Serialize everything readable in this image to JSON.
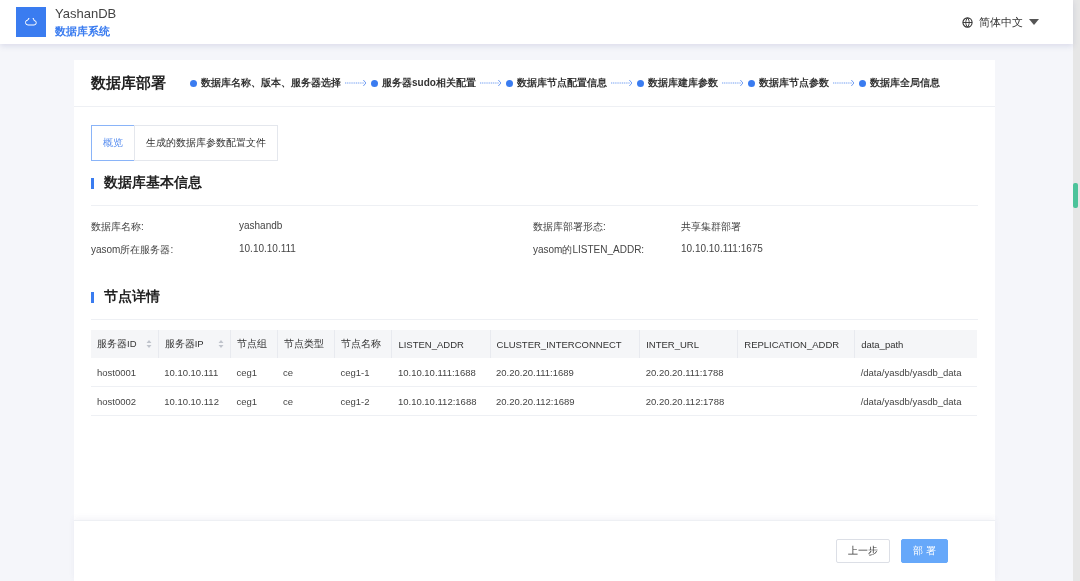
{
  "header": {
    "app_name": "YashanDB",
    "subtitle": "数据库系统",
    "language": "简体中文"
  },
  "page": {
    "title": "数据库部署",
    "steps": [
      {
        "label": "数据库名称、版本、服务器选择"
      },
      {
        "label": "服务器sudo相关配置"
      },
      {
        "label": "数据库节点配置信息"
      },
      {
        "label": "数据库建库参数"
      },
      {
        "label": "数据库节点参数"
      },
      {
        "label": "数据库全局信息"
      }
    ]
  },
  "tabs": [
    {
      "label": "概览",
      "selected": true
    },
    {
      "label": "生成的数据库参数配置文件",
      "selected": false
    }
  ],
  "basic_info": {
    "title": "数据库基本信息",
    "fields": [
      {
        "label": "数据库名称:",
        "value": "yashandb"
      },
      {
        "label": "数据库部署形态:",
        "value": "共享集群部署"
      },
      {
        "label": "yasom所在服务器:",
        "value": "10.10.10.111"
      },
      {
        "label": "yasom的LISTEN_ADDR:",
        "value": "10.10.10.111:1675"
      }
    ]
  },
  "nodes": {
    "title": "节点详情",
    "table": {
      "columns": [
        {
          "label": "服务器ID",
          "sortable": true
        },
        {
          "label": "服务器IP",
          "sortable": true
        },
        {
          "label": "节点组",
          "sortable": false
        },
        {
          "label": "节点类型",
          "sortable": false
        },
        {
          "label": "节点名称",
          "sortable": false
        },
        {
          "label": "LISTEN_ADDR",
          "sortable": false
        },
        {
          "label": "CLUSTER_INTERCONNECT",
          "sortable": false
        },
        {
          "label": "INTER_URL",
          "sortable": false
        },
        {
          "label": "REPLICATION_ADDR",
          "sortable": false
        },
        {
          "label": "data_path",
          "sortable": false
        }
      ],
      "rows": [
        [
          "host0001",
          "10.10.10.111",
          "ceg1",
          "ce",
          "ceg1-1",
          "10.10.10.111:1688",
          "20.20.20.111:1689",
          "20.20.20.111:1788",
          "",
          "/data/yasdb/yasdb_data"
        ],
        [
          "host0002",
          "10.10.10.112",
          "ceg1",
          "ce",
          "ceg1-2",
          "10.10.10.112:1688",
          "20.20.20.112:1689",
          "20.20.20.112:1788",
          "",
          "/data/yasdb/yasdb_data"
        ]
      ]
    }
  },
  "footer": {
    "buttons": [
      {
        "label": "上一步",
        "kind": "default"
      },
      {
        "label": "部 署",
        "kind": "primary"
      }
    ]
  }
}
